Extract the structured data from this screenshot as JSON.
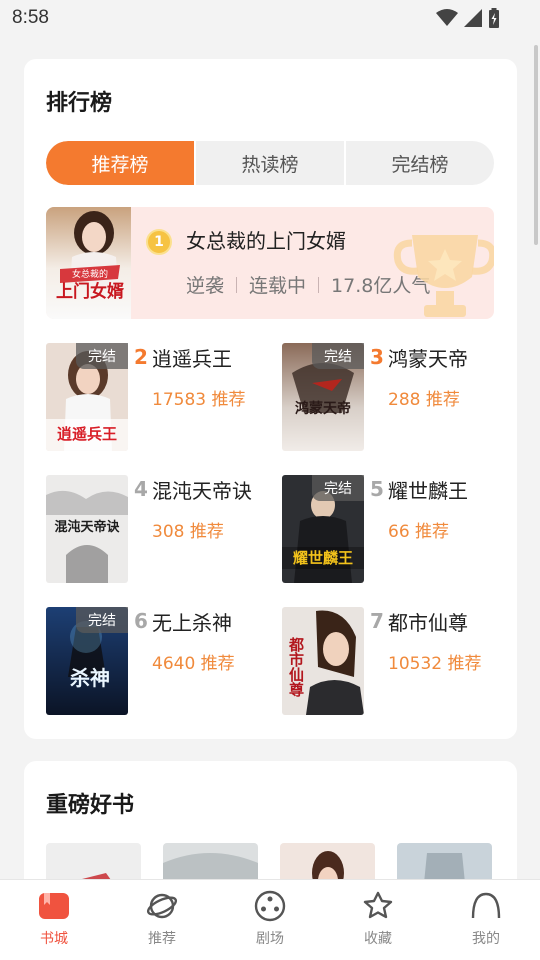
{
  "status_bar": {
    "time": "8:58"
  },
  "ranking": {
    "title": "排行榜",
    "tabs": [
      "推荐榜",
      "热读榜",
      "完结榜"
    ],
    "active_tab": "推荐榜",
    "top_book": {
      "rank": "1",
      "title": "女总裁的上门女婿",
      "genre": "逆袭",
      "status": "连载中",
      "popularity": "17.8亿人气",
      "cover_text": "上门女婿",
      "cover_subtext": "女总裁的"
    },
    "books": [
      {
        "rank": "2",
        "title": "逍遥兵王",
        "recommend": "17583 推荐",
        "completed": "完结",
        "cover_text": "逍遥兵王"
      },
      {
        "rank": "3",
        "title": "鸿蒙天帝",
        "recommend": "288 推荐",
        "completed": "完结",
        "cover_text": "鸿蒙天帝"
      },
      {
        "rank": "4",
        "title": "混沌天帝诀",
        "recommend": "308 推荐",
        "completed": "",
        "cover_text": "混沌天帝诀"
      },
      {
        "rank": "5",
        "title": "耀世麟王",
        "recommend": "66 推荐",
        "completed": "完结",
        "cover_text": "耀世麟王"
      },
      {
        "rank": "6",
        "title": "无上杀神",
        "recommend": "4640 推荐",
        "completed": "完结",
        "cover_text": "杀神"
      },
      {
        "rank": "7",
        "title": "都市仙尊",
        "recommend": "10532 推荐",
        "completed": "",
        "cover_text": "都市仙尊"
      }
    ]
  },
  "featured": {
    "title": "重磅好书"
  },
  "nav": {
    "items": [
      "书城",
      "推荐",
      "剧场",
      "收藏",
      "我的"
    ],
    "active": "书城"
  },
  "colors": {
    "accent": "#f47a2f",
    "nav_active": "#f0533f",
    "recommend_text": "#f08a3c"
  }
}
